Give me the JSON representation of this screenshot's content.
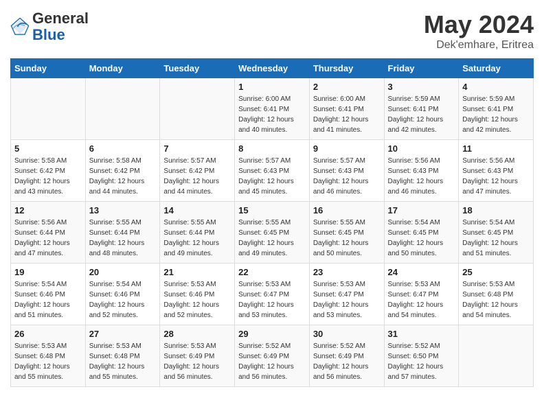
{
  "header": {
    "logo_general": "General",
    "logo_blue": "Blue",
    "month": "May 2024",
    "location": "Dek'emhare, Eritrea"
  },
  "weekdays": [
    "Sunday",
    "Monday",
    "Tuesday",
    "Wednesday",
    "Thursday",
    "Friday",
    "Saturday"
  ],
  "weeks": [
    [
      {
        "day": "",
        "info": ""
      },
      {
        "day": "",
        "info": ""
      },
      {
        "day": "",
        "info": ""
      },
      {
        "day": "1",
        "info": "Sunrise: 6:00 AM\nSunset: 6:41 PM\nDaylight: 12 hours\nand 40 minutes."
      },
      {
        "day": "2",
        "info": "Sunrise: 6:00 AM\nSunset: 6:41 PM\nDaylight: 12 hours\nand 41 minutes."
      },
      {
        "day": "3",
        "info": "Sunrise: 5:59 AM\nSunset: 6:41 PM\nDaylight: 12 hours\nand 42 minutes."
      },
      {
        "day": "4",
        "info": "Sunrise: 5:59 AM\nSunset: 6:41 PM\nDaylight: 12 hours\nand 42 minutes."
      }
    ],
    [
      {
        "day": "5",
        "info": "Sunrise: 5:58 AM\nSunset: 6:42 PM\nDaylight: 12 hours\nand 43 minutes."
      },
      {
        "day": "6",
        "info": "Sunrise: 5:58 AM\nSunset: 6:42 PM\nDaylight: 12 hours\nand 44 minutes."
      },
      {
        "day": "7",
        "info": "Sunrise: 5:57 AM\nSunset: 6:42 PM\nDaylight: 12 hours\nand 44 minutes."
      },
      {
        "day": "8",
        "info": "Sunrise: 5:57 AM\nSunset: 6:43 PM\nDaylight: 12 hours\nand 45 minutes."
      },
      {
        "day": "9",
        "info": "Sunrise: 5:57 AM\nSunset: 6:43 PM\nDaylight: 12 hours\nand 46 minutes."
      },
      {
        "day": "10",
        "info": "Sunrise: 5:56 AM\nSunset: 6:43 PM\nDaylight: 12 hours\nand 46 minutes."
      },
      {
        "day": "11",
        "info": "Sunrise: 5:56 AM\nSunset: 6:43 PM\nDaylight: 12 hours\nand 47 minutes."
      }
    ],
    [
      {
        "day": "12",
        "info": "Sunrise: 5:56 AM\nSunset: 6:44 PM\nDaylight: 12 hours\nand 47 minutes."
      },
      {
        "day": "13",
        "info": "Sunrise: 5:55 AM\nSunset: 6:44 PM\nDaylight: 12 hours\nand 48 minutes."
      },
      {
        "day": "14",
        "info": "Sunrise: 5:55 AM\nSunset: 6:44 PM\nDaylight: 12 hours\nand 49 minutes."
      },
      {
        "day": "15",
        "info": "Sunrise: 5:55 AM\nSunset: 6:45 PM\nDaylight: 12 hours\nand 49 minutes."
      },
      {
        "day": "16",
        "info": "Sunrise: 5:55 AM\nSunset: 6:45 PM\nDaylight: 12 hours\nand 50 minutes."
      },
      {
        "day": "17",
        "info": "Sunrise: 5:54 AM\nSunset: 6:45 PM\nDaylight: 12 hours\nand 50 minutes."
      },
      {
        "day": "18",
        "info": "Sunrise: 5:54 AM\nSunset: 6:45 PM\nDaylight: 12 hours\nand 51 minutes."
      }
    ],
    [
      {
        "day": "19",
        "info": "Sunrise: 5:54 AM\nSunset: 6:46 PM\nDaylight: 12 hours\nand 51 minutes."
      },
      {
        "day": "20",
        "info": "Sunrise: 5:54 AM\nSunset: 6:46 PM\nDaylight: 12 hours\nand 52 minutes."
      },
      {
        "day": "21",
        "info": "Sunrise: 5:53 AM\nSunset: 6:46 PM\nDaylight: 12 hours\nand 52 minutes."
      },
      {
        "day": "22",
        "info": "Sunrise: 5:53 AM\nSunset: 6:47 PM\nDaylight: 12 hours\nand 53 minutes."
      },
      {
        "day": "23",
        "info": "Sunrise: 5:53 AM\nSunset: 6:47 PM\nDaylight: 12 hours\nand 53 minutes."
      },
      {
        "day": "24",
        "info": "Sunrise: 5:53 AM\nSunset: 6:47 PM\nDaylight: 12 hours\nand 54 minutes."
      },
      {
        "day": "25",
        "info": "Sunrise: 5:53 AM\nSunset: 6:48 PM\nDaylight: 12 hours\nand 54 minutes."
      }
    ],
    [
      {
        "day": "26",
        "info": "Sunrise: 5:53 AM\nSunset: 6:48 PM\nDaylight: 12 hours\nand 55 minutes."
      },
      {
        "day": "27",
        "info": "Sunrise: 5:53 AM\nSunset: 6:48 PM\nDaylight: 12 hours\nand 55 minutes."
      },
      {
        "day": "28",
        "info": "Sunrise: 5:53 AM\nSunset: 6:49 PM\nDaylight: 12 hours\nand 56 minutes."
      },
      {
        "day": "29",
        "info": "Sunrise: 5:52 AM\nSunset: 6:49 PM\nDaylight: 12 hours\nand 56 minutes."
      },
      {
        "day": "30",
        "info": "Sunrise: 5:52 AM\nSunset: 6:49 PM\nDaylight: 12 hours\nand 56 minutes."
      },
      {
        "day": "31",
        "info": "Sunrise: 5:52 AM\nSunset: 6:50 PM\nDaylight: 12 hours\nand 57 minutes."
      },
      {
        "day": "",
        "info": ""
      }
    ]
  ]
}
